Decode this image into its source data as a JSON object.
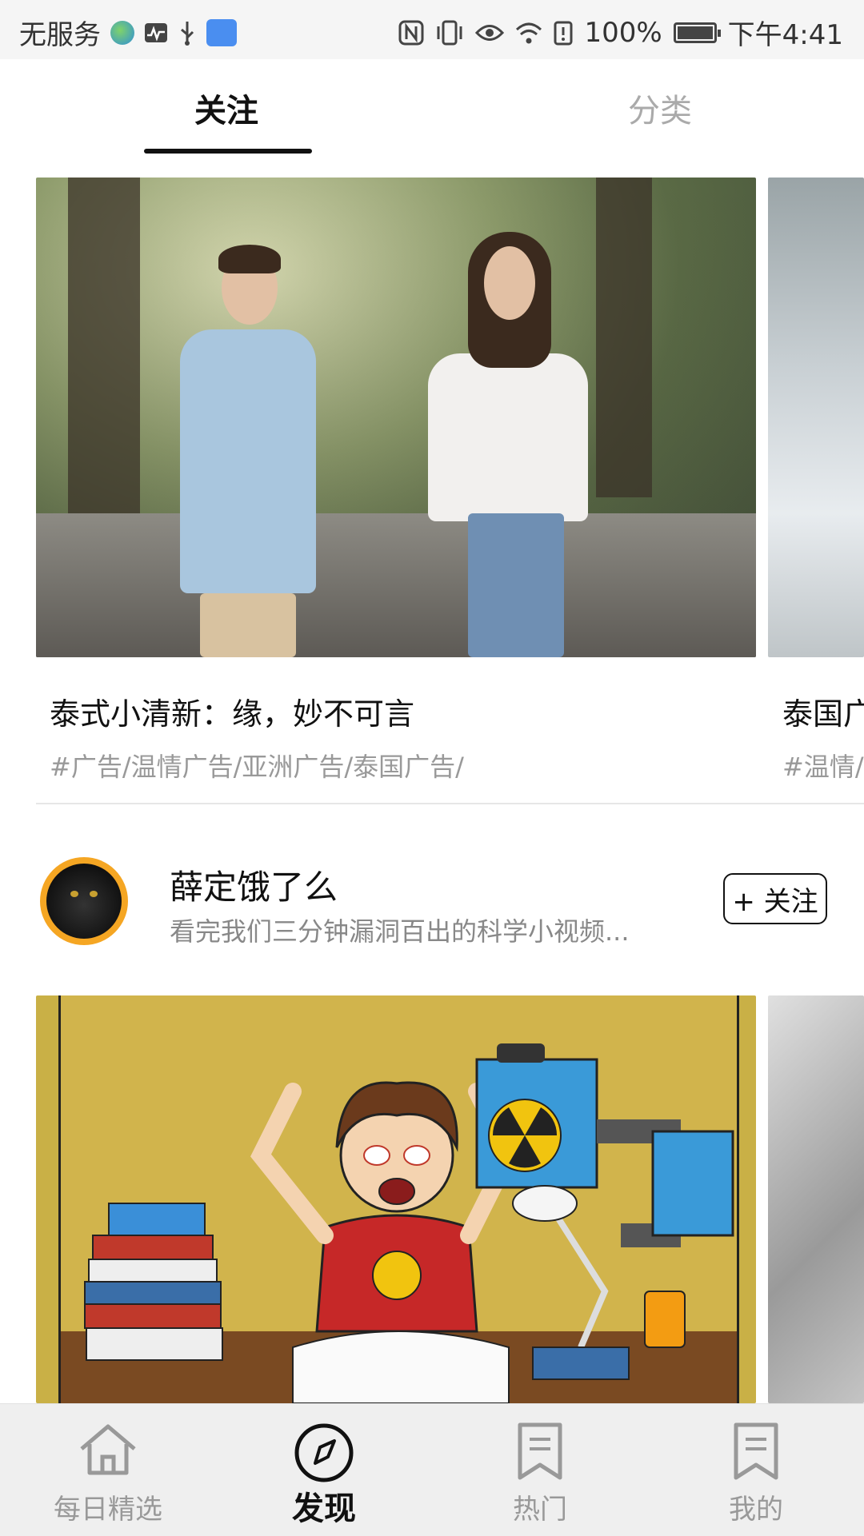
{
  "status_bar": {
    "carrier": "无服务",
    "battery": "100%",
    "time": "下午4:41",
    "battery_level": 1.0,
    "icons": [
      "globe-icon",
      "activity-icon",
      "usb-icon",
      "app-notification-icon",
      "nfc-icon",
      "vibrate-icon",
      "eye-icon",
      "wifi-icon",
      "battery-alert-icon",
      "battery-icon"
    ]
  },
  "tabs": [
    {
      "label": "关注",
      "active": true
    },
    {
      "label": "分类",
      "active": false
    }
  ],
  "cards_row1": [
    {
      "title": "泰式小清新：缘，妙不可言",
      "tags": "#广告/温情广告/亚洲广告/泰国广告/"
    },
    {
      "title": "泰国广",
      "tags": "#温情/"
    }
  ],
  "author": {
    "name": "薛定饿了么",
    "desc": "看完我们三分钟漏洞百出的科学小视频...",
    "follow_label": "+ 关注"
  },
  "bottom_nav": [
    {
      "label": "每日精选",
      "icon": "home-icon",
      "active": false
    },
    {
      "label": "发现",
      "icon": "compass-icon",
      "active": true
    },
    {
      "label": "热门",
      "icon": "bookmark-icon",
      "active": false
    },
    {
      "label": "我的",
      "icon": "bookmark-icon",
      "active": false
    }
  ],
  "colors": {
    "accent": "#111111",
    "inactive": "#999999",
    "avatar_ring": "#f5a623"
  }
}
